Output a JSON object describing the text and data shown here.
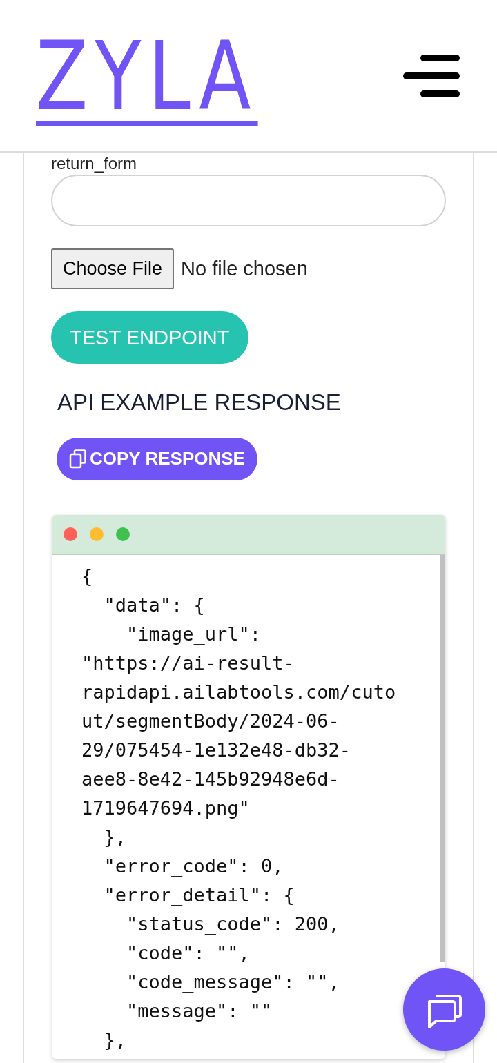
{
  "header": {
    "logo": "ZYLA"
  },
  "form": {
    "field_label": "return_form",
    "file_button": "Choose File",
    "file_status": "No file chosen",
    "test_button": "TEST ENDPOINT"
  },
  "response": {
    "heading": "API EXAMPLE RESPONSE",
    "copy_button": "COPY RESPONSE",
    "code_lines": [
      "{",
      "  \"data\": {",
      "    \"image_url\":",
      "\"https://ai-result-",
      "rapidapi.ailabtools.com/cuto",
      "ut/segmentBody/2024-06-",
      "29/075454-1e132e48-db32-",
      "aee8-8e42-145b92948e6d-",
      "1719647694.png\"",
      "  },",
      "  \"error_code\": 0,",
      "  \"error_detail\": {",
      "    \"status_code\": 200,",
      "    \"code\": \"\",",
      "    \"code_message\": \"\",",
      "    \"message\": \"\"",
      "  },"
    ]
  }
}
